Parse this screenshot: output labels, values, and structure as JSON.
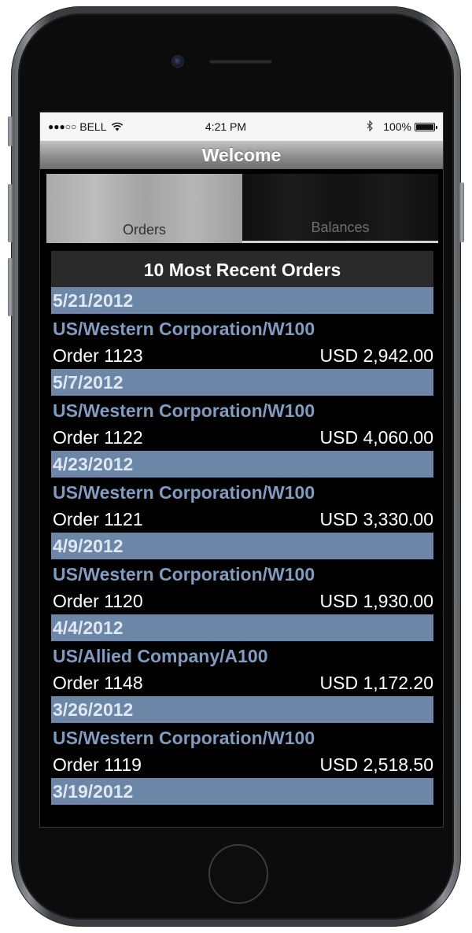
{
  "status_bar": {
    "signal": "●●●○○",
    "carrier": "BELL",
    "wifi_icon": "wifi-icon",
    "time": "4:21 PM",
    "bluetooth_icon": "bluetooth-icon",
    "battery_percent": "100%",
    "battery_level": 1.0
  },
  "header": {
    "title": "Welcome"
  },
  "tabs": [
    {
      "label": "Orders",
      "selected": true
    },
    {
      "label": "Balances",
      "selected": false
    }
  ],
  "orders": {
    "heading": "10 Most Recent Orders",
    "items": [
      {
        "date": "5/21/2012",
        "company": "US/Western Corporation/W100",
        "order": "Order  1123",
        "amount": "USD 2,942.00"
      },
      {
        "date": "5/7/2012",
        "company": "US/Western Corporation/W100",
        "order": "Order  1122",
        "amount": "USD 4,060.00"
      },
      {
        "date": "4/23/2012",
        "company": "US/Western Corporation/W100",
        "order": "Order  1121",
        "amount": "USD 3,330.00"
      },
      {
        "date": "4/9/2012",
        "company": "US/Western Corporation/W100",
        "order": "Order  1120",
        "amount": "USD 1,930.00"
      },
      {
        "date": "4/4/2012",
        "company": "US/Allied Company/A100",
        "order": "Order  1148",
        "amount": "USD 1,172.20"
      },
      {
        "date": "3/26/2012",
        "company": "US/Western Corporation/W100",
        "order": "Order  1119",
        "amount": "USD 2,518.50"
      },
      {
        "date": "3/19/2012"
      }
    ]
  },
  "colors": {
    "date_band": "#6b86a6",
    "company_text": "#7f9cc2",
    "header_bar": "#2a2a2a"
  }
}
